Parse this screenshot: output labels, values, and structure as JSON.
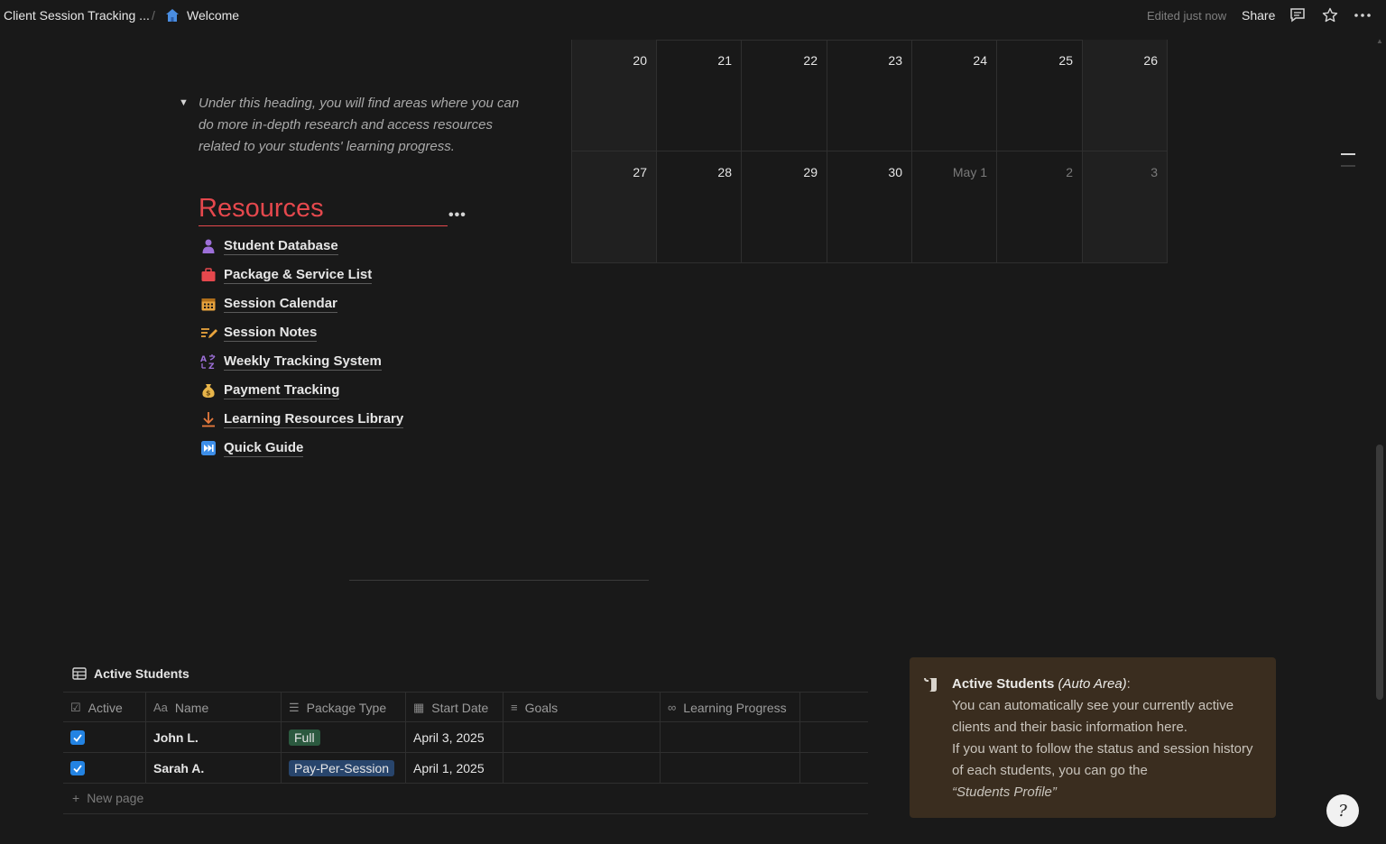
{
  "topbar": {
    "breadcrumb_parent": "Client Session Tracking ...",
    "breadcrumb_sep": "/",
    "breadcrumb_current": "Welcome",
    "edited_status": "Edited just now",
    "share_label": "Share",
    "icons": [
      "comment-icon",
      "star-icon",
      "more-icon"
    ]
  },
  "calendar": {
    "weeks": [
      [
        {
          "d": "20"
        },
        {
          "d": "21"
        },
        {
          "d": "22"
        },
        {
          "d": "23"
        },
        {
          "d": "24"
        },
        {
          "d": "25"
        },
        {
          "d": "26"
        }
      ],
      [
        {
          "d": "27"
        },
        {
          "d": "28"
        },
        {
          "d": "29"
        },
        {
          "d": "30"
        },
        {
          "d": "May 1",
          "muted": true
        },
        {
          "d": "2",
          "muted": true
        },
        {
          "d": "3",
          "muted": true
        }
      ]
    ]
  },
  "toggle": {
    "text": "Under this heading, you will find areas where you can do more in-depth research and access resources related to your students' learning progress."
  },
  "resources": {
    "title": "Resources",
    "more": "•••",
    "links": [
      {
        "label": "Student Database",
        "icon": "person-icon",
        "color": "#9d6fd8"
      },
      {
        "label": "Package & Service List",
        "icon": "briefcase-icon",
        "color": "#e5484d"
      },
      {
        "label": "Session Calendar",
        "icon": "calendar-icon",
        "color": "#e8a33d"
      },
      {
        "label": "Session Notes",
        "icon": "notes-pen-icon",
        "color": "#e8a33d"
      },
      {
        "label": "Weekly Tracking System",
        "icon": "translate-icon",
        "color": "#9d6fd8"
      },
      {
        "label": "Payment Tracking",
        "icon": "money-bag-icon",
        "color": "#e8b54a"
      },
      {
        "label": "Learning Resources Library",
        "icon": "download-icon",
        "color": "#e87a3d"
      },
      {
        "label": "Quick Guide",
        "icon": "fast-forward-icon",
        "color": "#3d8ee8"
      }
    ]
  },
  "database": {
    "title": "Active Students",
    "columns": [
      {
        "label": "Active",
        "icon": "☑"
      },
      {
        "label": "Name",
        "icon": "Aa"
      },
      {
        "label": "Package Type",
        "icon": "☰"
      },
      {
        "label": "Start Date",
        "icon": "▦"
      },
      {
        "label": "Goals",
        "icon": "≡"
      },
      {
        "label": "Learning Progress",
        "icon": "∞"
      },
      {
        "label": "",
        "icon": ""
      }
    ],
    "rows": [
      {
        "active": true,
        "name": "John L.",
        "package": "Full",
        "package_color": "green",
        "start": "April 3, 2025"
      },
      {
        "active": true,
        "name": "Sarah A.",
        "package": "Pay-Per-Session",
        "package_color": "blue",
        "start": "April 1, 2025"
      }
    ],
    "new_page": "New page"
  },
  "callout": {
    "title": "Active Students",
    "title_suffix": " (Auto Area)",
    "colon": ":",
    "line1": "You can automatically see your currently active clients and their basic information here.",
    "line2": "If you want to follow the status and session history of each students, you can go the",
    "quote": "“Students Profile”"
  },
  "colors": {
    "background": "#191919",
    "accent_red": "#e5484d",
    "checkbox_blue": "#2383e2",
    "callout_bg": "#3a2d1f"
  }
}
